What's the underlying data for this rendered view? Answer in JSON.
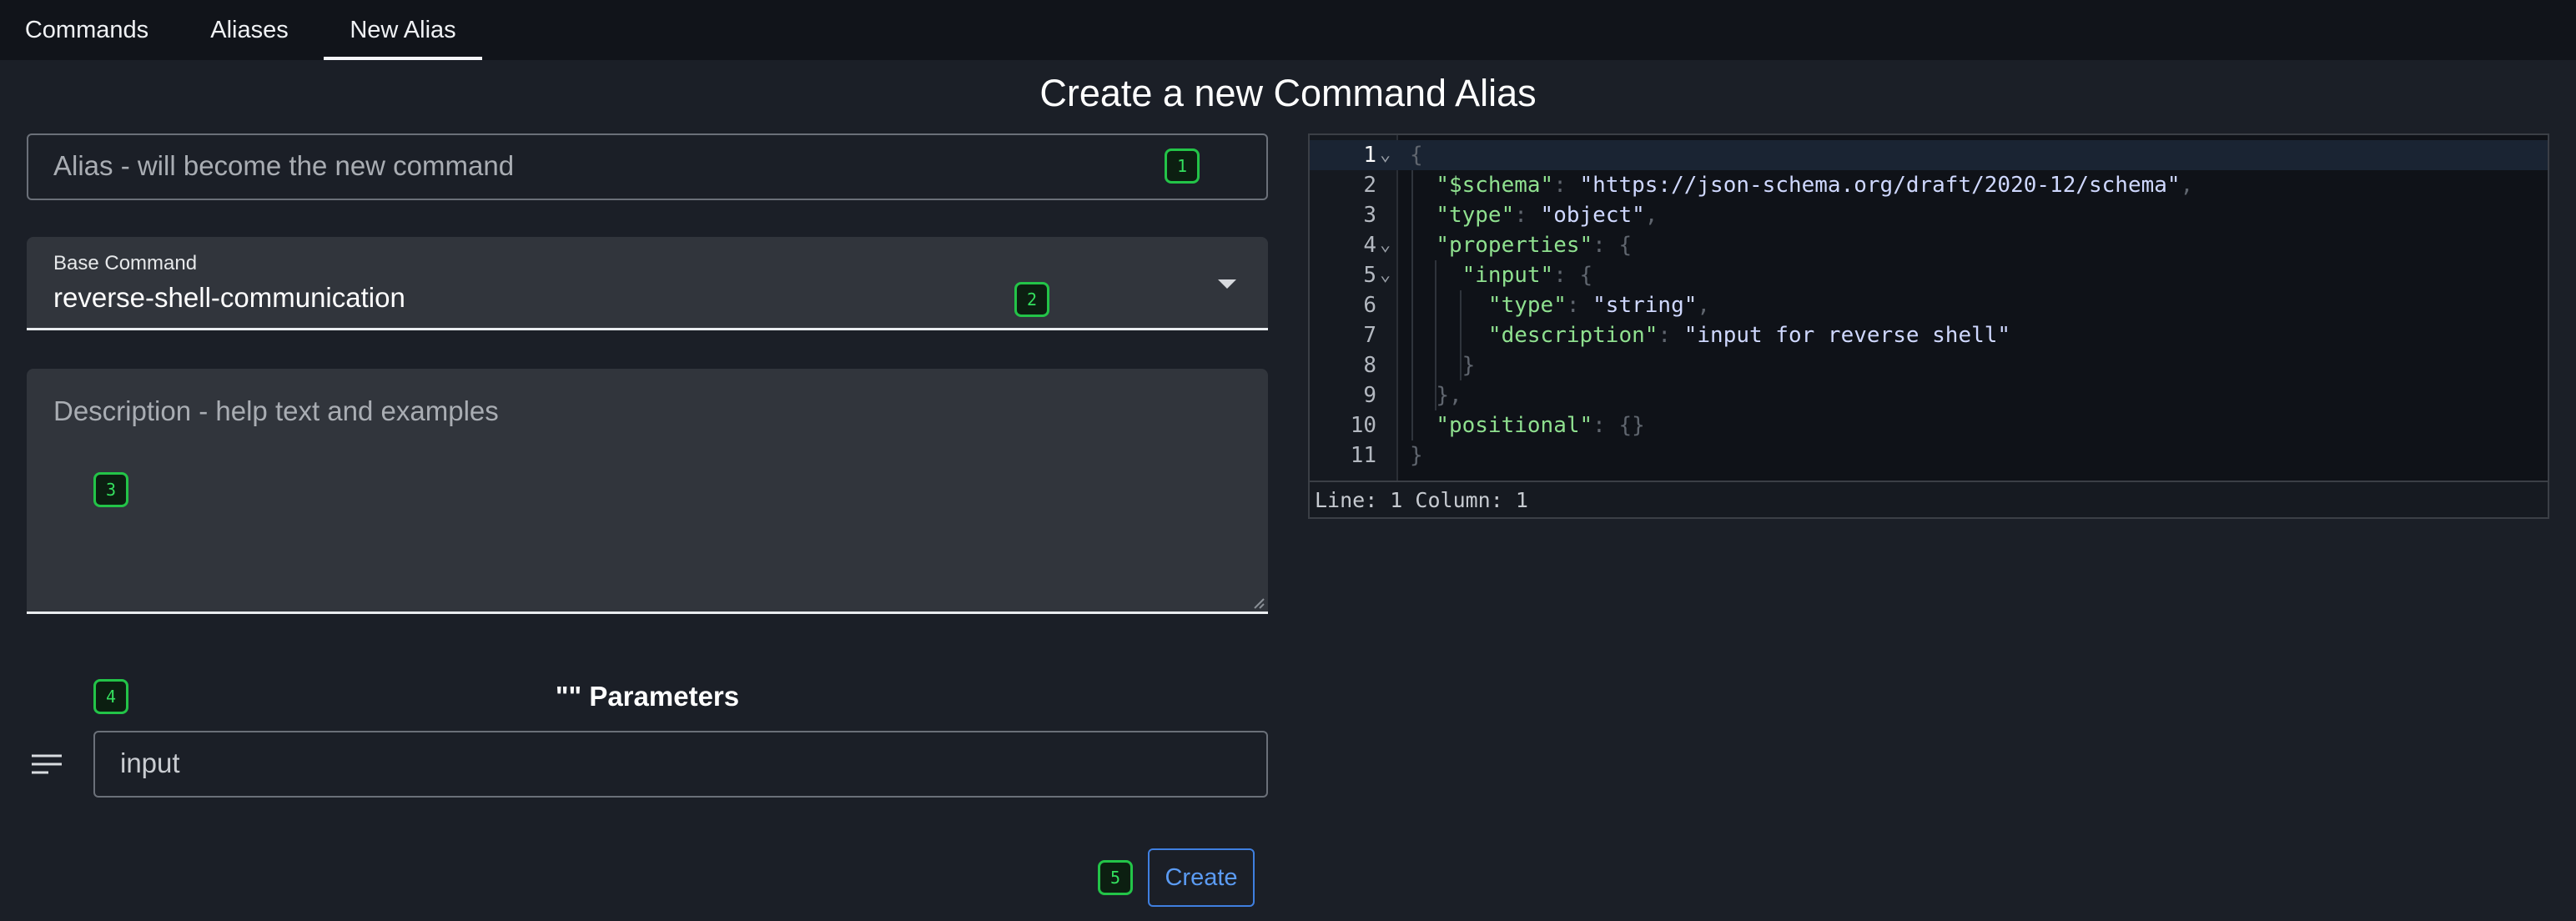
{
  "tabs": [
    {
      "label": "Commands"
    },
    {
      "label": "Aliases"
    },
    {
      "label": "New Alias",
      "active": true
    }
  ],
  "page": {
    "title": "Create a new Command Alias"
  },
  "form": {
    "alias_placeholder": "Alias - will become the new command",
    "base_command_label": "Base Command",
    "base_command_value": "reverse-shell-communication",
    "description_placeholder": "Description - help text and examples",
    "params_title": "\"\" Parameters",
    "param_value": "input",
    "create_label": "Create"
  },
  "badges": [
    "1",
    "2",
    "3",
    "4",
    "5"
  ],
  "editor": {
    "line_numbers": [
      "1",
      "2",
      "3",
      "4",
      "5",
      "6",
      "7",
      "8",
      "9",
      "10",
      "11"
    ],
    "status": "Line: 1  Column: 1",
    "lines": [
      {
        "indent": "",
        "key": "",
        "sep": "",
        "value": "",
        "tail": "{"
      },
      {
        "indent": "  ",
        "key": "\"$schema\"",
        "sep": ": ",
        "value": "\"https://json-schema.org/draft/2020-12/schema\"",
        "tail": ","
      },
      {
        "indent": "  ",
        "key": "\"type\"",
        "sep": ": ",
        "value": "\"object\"",
        "tail": ","
      },
      {
        "indent": "  ",
        "key": "\"properties\"",
        "sep": ": ",
        "value": "",
        "tail": "{"
      },
      {
        "indent": "    ",
        "key": "\"input\"",
        "sep": ": ",
        "value": "",
        "tail": "{"
      },
      {
        "indent": "      ",
        "key": "\"type\"",
        "sep": ": ",
        "value": "\"string\"",
        "tail": ","
      },
      {
        "indent": "      ",
        "key": "\"description\"",
        "sep": ": ",
        "value": "\"input for reverse shell\"",
        "tail": ""
      },
      {
        "indent": "    ",
        "key": "",
        "sep": "",
        "value": "",
        "tail": "}"
      },
      {
        "indent": "  ",
        "key": "",
        "sep": "",
        "value": "",
        "tail": "},"
      },
      {
        "indent": "  ",
        "key": "\"positional\"",
        "sep": ": ",
        "value": "",
        "tail": "{}"
      },
      {
        "indent": "",
        "key": "",
        "sep": "",
        "value": "",
        "tail": "}"
      }
    ]
  },
  "icons": {
    "param_drag": "menu-lines-icon",
    "dropdown": "caret-down-icon",
    "fold": "chevron-down-icon"
  },
  "colors": {
    "badge": "#23c448",
    "accent": "#3f7fe0",
    "json_key": "#8fe08f"
  }
}
